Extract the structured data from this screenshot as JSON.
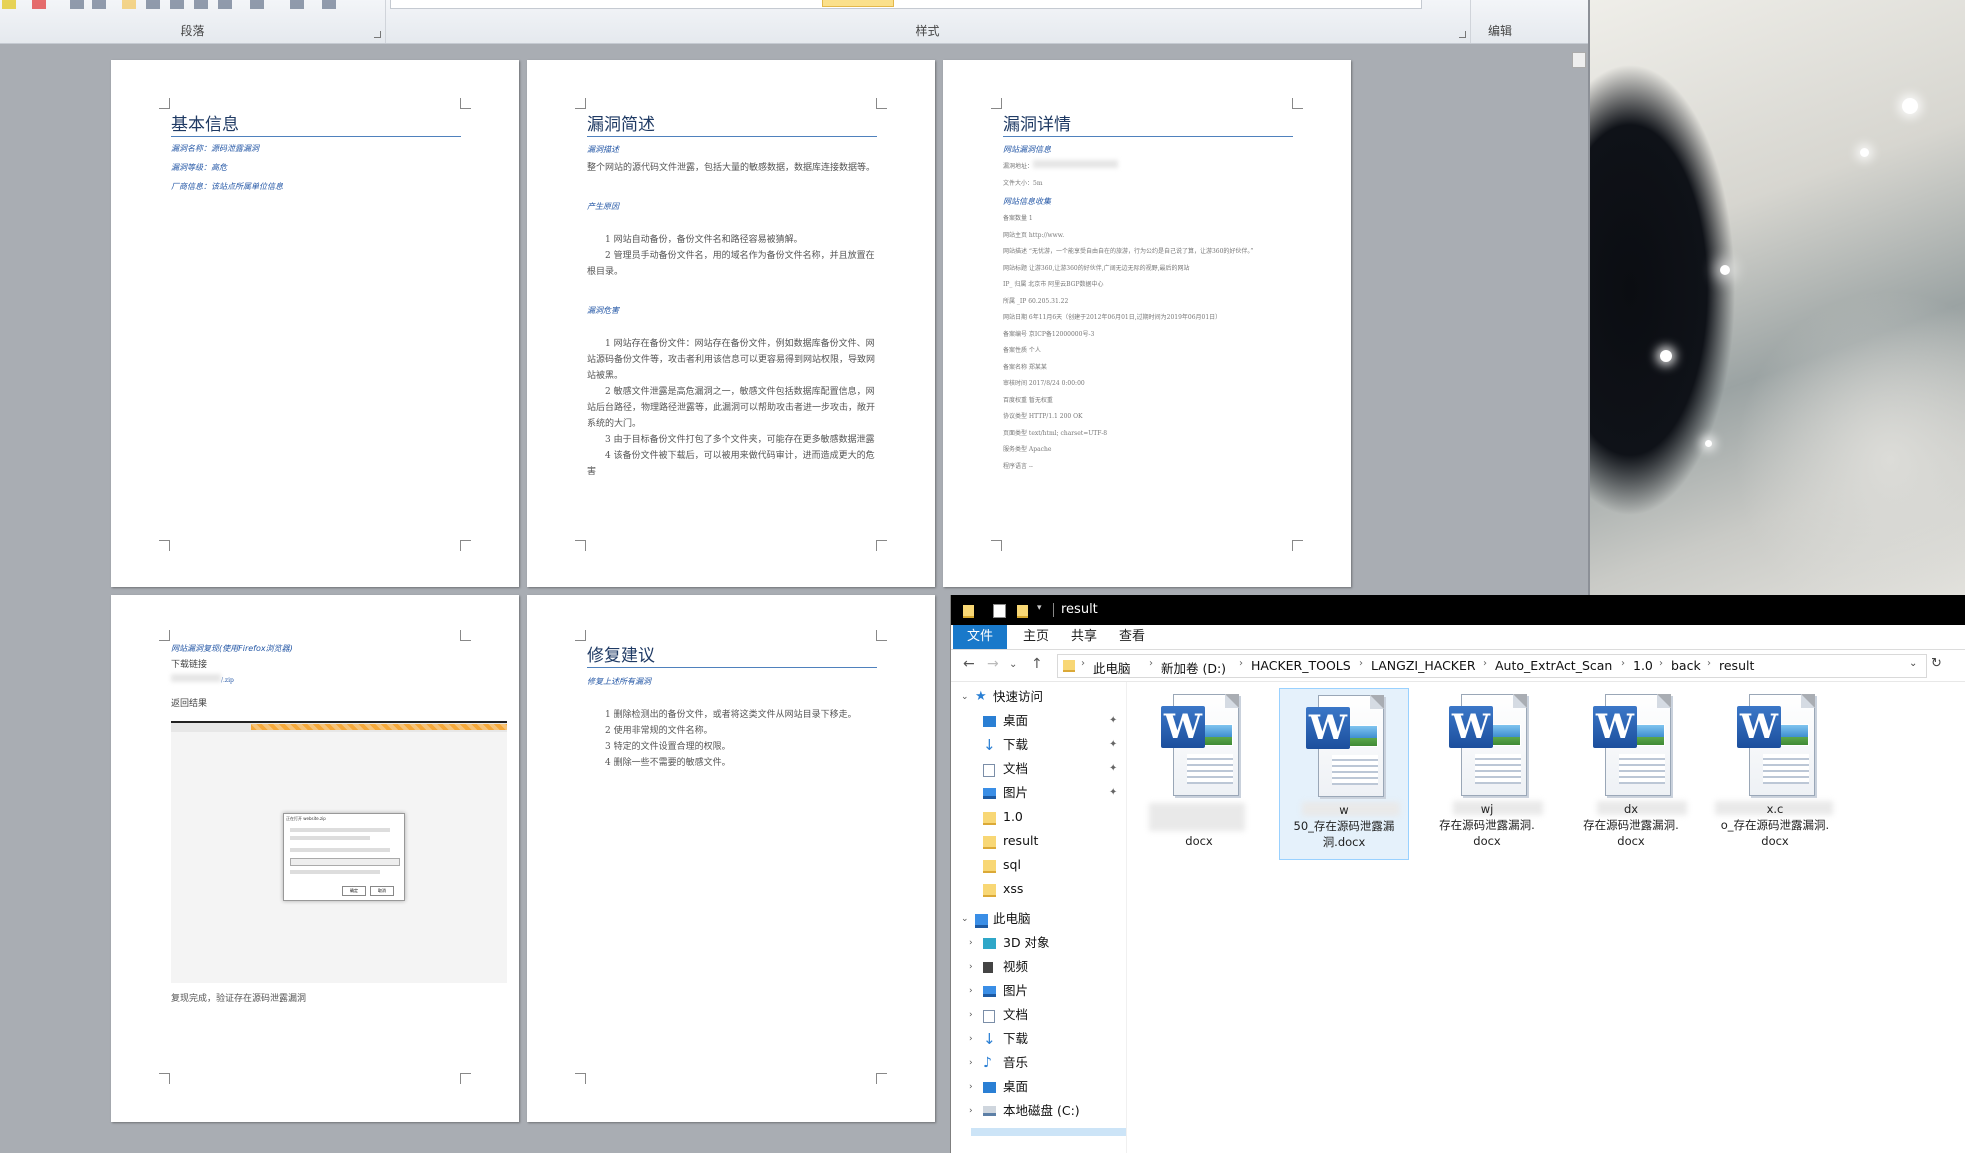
{
  "ribbon": {
    "groups": [
      "段落",
      "样式",
      "编辑"
    ]
  },
  "pages": {
    "p1": {
      "title": "基本信息",
      "lines": [
        "漏洞名称：源码泄露漏洞",
        "漏洞等级：高危",
        "厂商信息：该站点所属单位信息"
      ]
    },
    "p2": {
      "title": "漏洞简述",
      "h1": "漏洞描述",
      "desc": "整个网站的源代码文件泄露，包括大量的敏感数据，数据库连接数据等。",
      "h2": "产生原因",
      "causes": [
        "1 网站自动备份，备份文件名和路径容易被猜解。",
        "2 管理员手动备份文件名，用的域名作为备份文件名称，并且放置在根目录。"
      ],
      "h3": "漏洞危害",
      "harms": [
        "1 网站存在备份文件：网站存在备份文件，例如数据库备份文件、网站源码备份文件等，攻击者利用该信息可以更容易得到网站权限，导致网站被黑。",
        "2 敏感文件泄露是高危漏洞之一，敏感文件包括数据库配置信息，网站后台路径，物理路径泄露等，此漏洞可以帮助攻击者进一步攻击，敞开系统的大门。",
        "3 由于目标备份文件打包了多个文件夹，可能存在更多敏感数据泄露",
        "4 该备份文件被下载后，可以被用来做代码审计，进而造成更大的危害"
      ]
    },
    "p3": {
      "title": "漏洞详情",
      "h1": "网站漏洞信息",
      "pre": [
        "漏洞地址：",
        "文件大小：5m"
      ],
      "h2": "网站信息收集",
      "rows": [
        "备案数量 1",
        "网站主页 http://www.",
        "网站描述 “无忧游，一个能享受自由自在的旅游，行为公约是自己说了算，让游360的好伙伴。”",
        "网站标题 让游360,让游360的好伙伴,广阔无边无际的视野,最后的网站",
        "IP_ 归属 北京市 阿里云BGP数据中心",
        "所属 _IP 60.205.31.22",
        "网站日期 6年11月6天（创建于2012年06月01日,过期时间为2019年06月01日）",
        "备案编号 京ICP备12000000号-3",
        "备案性质 个人",
        "备案名称 郑某某",
        "审核时间 2017/8/24 0:00:00",
        "百度权重 暂无权重",
        "协议类型 HTTP/1.1 200 OK",
        "页面类型 text/html; charset=UTF-8",
        "服务类型 Apache",
        "程序语言 --"
      ]
    },
    "p4": {
      "h1": "网站漏洞复现(使用Firefox浏览器)",
      "download": "下载链接",
      "link": "/.zip",
      "result": "返回结果",
      "footer": "复现完成，验证存在源码泄露漏洞",
      "dialog_title": "正在打开 website.zip",
      "dialog_btn1": "确定",
      "dialog_btn2": "取消"
    },
    "p5": {
      "title": "修复建议",
      "h1": "修复上述所有漏洞",
      "items": [
        "1 删除检测出的备份文件，或者将这类文件从网站目录下移走。",
        "2 使用非常规的文件名称。",
        "3 特定的文件设置合理的权限。",
        "4 删除一些不需要的敏感文件。"
      ]
    }
  },
  "explorer": {
    "title": "result",
    "tabs": [
      "文件",
      "主页",
      "共享",
      "查看"
    ],
    "breadcrumbs": [
      "此电脑",
      "新加卷 (D:)",
      "HACKER_TOOLS",
      "LANGZI_HACKER",
      "Auto_ExtrAct_Scan",
      "1.0",
      "back",
      "result"
    ],
    "quick_access_label": "快速访问",
    "quick_access": [
      {
        "label": "桌面",
        "icon": "desktop-icon",
        "pinned": true
      },
      {
        "label": "下载",
        "icon": "download-icon",
        "pinned": true
      },
      {
        "label": "文档",
        "icon": "document-icon",
        "pinned": true
      },
      {
        "label": "图片",
        "icon": "picture-icon",
        "pinned": true
      },
      {
        "label": "1.0",
        "icon": "folder-icon",
        "pinned": false
      },
      {
        "label": "result",
        "icon": "folder-icon",
        "pinned": false
      },
      {
        "label": "sql",
        "icon": "folder-icon",
        "pinned": false
      },
      {
        "label": "xss",
        "icon": "folder-icon",
        "pinned": false
      }
    ],
    "this_pc_label": "此电脑",
    "this_pc": [
      {
        "label": "3D 对象",
        "icon": "3d-objects-icon"
      },
      {
        "label": "视频",
        "icon": "video-icon"
      },
      {
        "label": "图片",
        "icon": "picture-icon"
      },
      {
        "label": "文档",
        "icon": "document-icon"
      },
      {
        "label": "下载",
        "icon": "download-icon"
      },
      {
        "label": "音乐",
        "icon": "music-icon"
      },
      {
        "label": "桌面",
        "icon": "desktop-icon"
      },
      {
        "label": "本地磁盘 (C:)",
        "icon": "drive-icon"
      }
    ],
    "files": [
      {
        "line1": "",
        "line2": "docx",
        "selected": false
      },
      {
        "line1": "w",
        "line2": "50_存在源码泄露漏",
        "line3": "洞.docx",
        "selected": true
      },
      {
        "line1": "wj",
        "line2": "存在源码泄露漏洞.",
        "line3": "docx",
        "selected": false
      },
      {
        "line1": "dx",
        "line2": "存在源码泄露漏洞.",
        "line3": "docx",
        "selected": false
      },
      {
        "line1": "x.c",
        "line2": "o_存在源码泄露漏洞.",
        "line3": "docx",
        "selected": false
      }
    ]
  }
}
